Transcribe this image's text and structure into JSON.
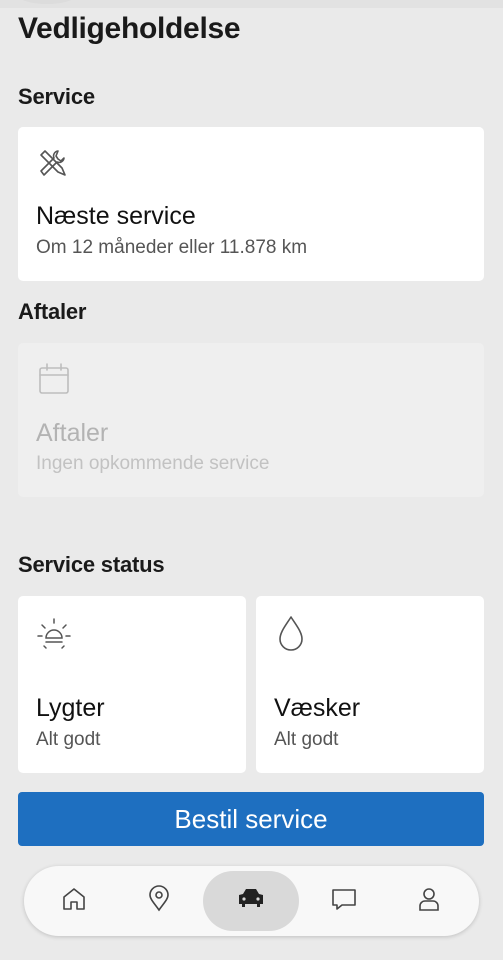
{
  "page": {
    "title": "Vedligeholdelse"
  },
  "service_section": {
    "heading": "Service",
    "next_service": {
      "title": "Næste service",
      "subtitle": "Om 12 måneder eller 11.878 km",
      "icon": "tools-icon"
    }
  },
  "appointments_section": {
    "heading": "Aftaler",
    "card": {
      "title": "Aftaler",
      "subtitle": "Ingen opkommende service",
      "icon": "calendar-icon"
    }
  },
  "status_section": {
    "heading": "Service status",
    "items": [
      {
        "title": "Lygter",
        "subtitle": "Alt godt",
        "icon": "light-bulb-icon"
      },
      {
        "title": "Væsker",
        "subtitle": "Alt godt",
        "icon": "droplet-icon"
      }
    ]
  },
  "cta": {
    "label": "Bestil service",
    "color": "#1e6fc0"
  },
  "bottom_nav": {
    "items": [
      {
        "icon": "home-icon",
        "active": false
      },
      {
        "icon": "location-pin-icon",
        "active": false
      },
      {
        "icon": "car-icon",
        "active": true
      },
      {
        "icon": "chat-icon",
        "active": false
      },
      {
        "icon": "profile-icon",
        "active": false
      }
    ]
  }
}
